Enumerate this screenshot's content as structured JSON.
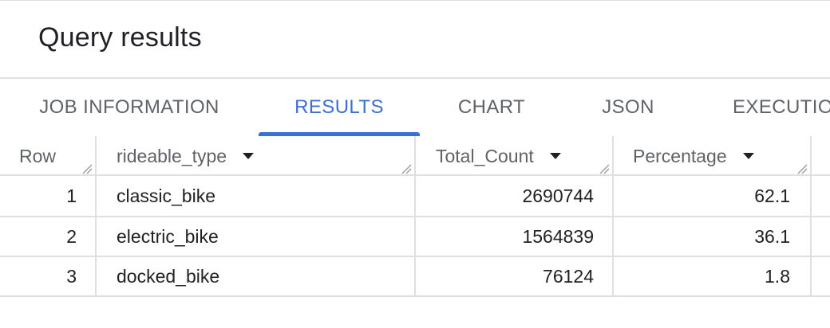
{
  "page": {
    "title": "Query results"
  },
  "tabs": [
    {
      "label": "JOB INFORMATION",
      "active": false
    },
    {
      "label": "RESULTS",
      "active": true
    },
    {
      "label": "CHART",
      "active": false
    },
    {
      "label": "JSON",
      "active": false
    },
    {
      "label": "EXECUTION DETAILS",
      "active": false
    }
  ],
  "table": {
    "columns": [
      "Row",
      "rideable_type",
      "Total_Count",
      "Percentage"
    ],
    "rows": [
      {
        "row": "1",
        "rideable_type": "classic_bike",
        "total_count": "2690744",
        "percentage": "62.1"
      },
      {
        "row": "2",
        "rideable_type": "electric_bike",
        "total_count": "1564839",
        "percentage": "36.1"
      },
      {
        "row": "3",
        "rideable_type": "docked_bike",
        "total_count": "76124",
        "percentage": "1.8"
      }
    ]
  },
  "colors": {
    "accent": "#3b6fd4",
    "border": "#e0e0e0",
    "muted_text": "#5f6368"
  }
}
